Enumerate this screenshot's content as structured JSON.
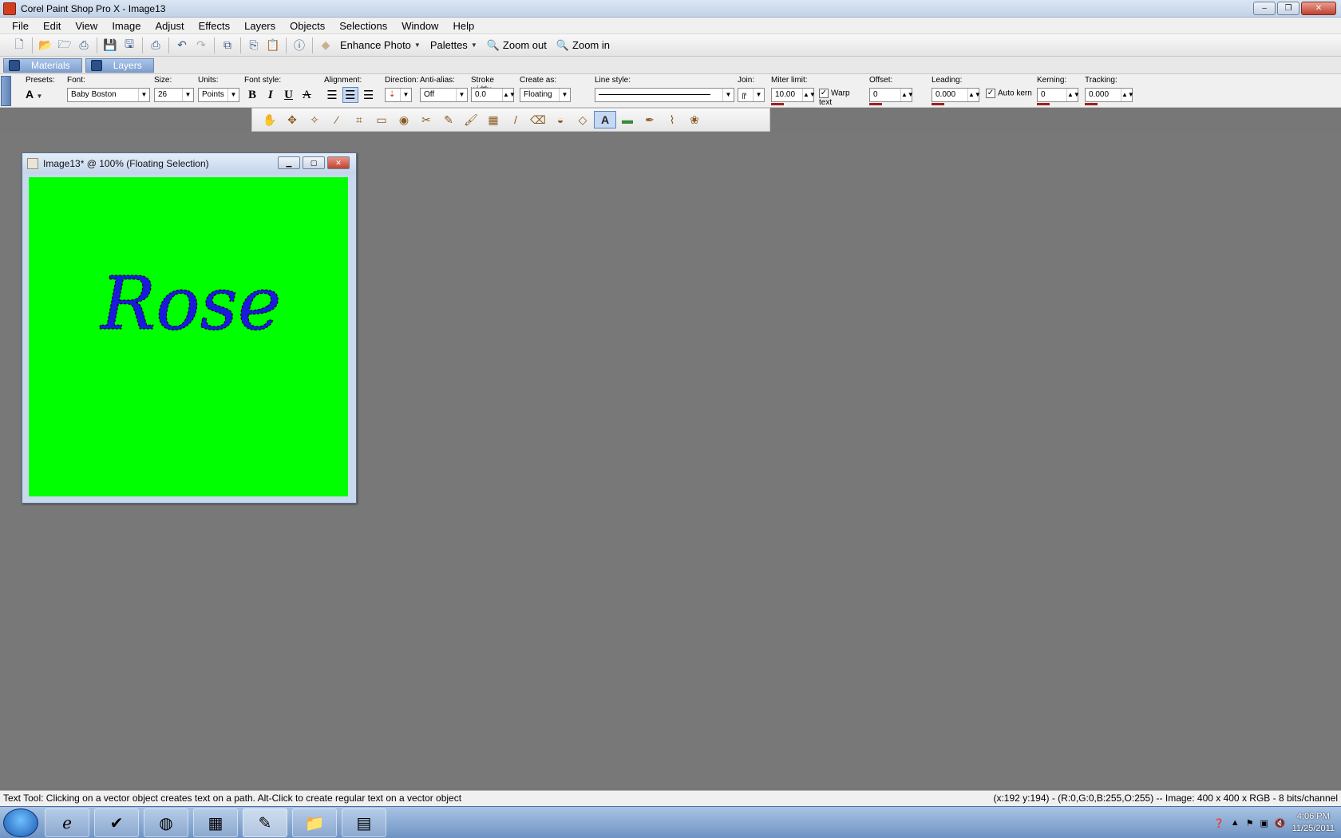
{
  "window": {
    "title": "Corel Paint Shop Pro X - Image13",
    "min": "–",
    "max": "❐",
    "close": "✕"
  },
  "menu": [
    "File",
    "Edit",
    "View",
    "Image",
    "Adjust",
    "Effects",
    "Layers",
    "Objects",
    "Selections",
    "Window",
    "Help"
  ],
  "toolbar": {
    "enhance_photo": "Enhance Photo",
    "palettes": "Palettes",
    "zoom_out": "Zoom out",
    "zoom_in": "Zoom in"
  },
  "palette_tabs": {
    "materials": "Materials",
    "layers": "Layers"
  },
  "options": {
    "presets_label": "Presets:",
    "presets_value": "A",
    "font_label": "Font:",
    "font_value": "Baby Boston",
    "size_label": "Size:",
    "size_value": "26",
    "units_label": "Units:",
    "units_value": "Points",
    "fontstyle_label": "Font style:",
    "bold": "B",
    "italic": "I",
    "underline": "U",
    "strike": "A",
    "alignment_label": "Alignment:",
    "direction_label": "Direction:",
    "antialias_label": "Anti-alias:",
    "antialias_value": "Off",
    "stroke_label": "Stroke width:",
    "stroke_value": "0.0",
    "createas_label": "Create as:",
    "createas_value": "Floating",
    "linestyle_label": "Line style:",
    "join_label": "Join:",
    "miter_label": "Miter limit:",
    "miter_value": "10.00",
    "warp_label": "Warp text",
    "warp_checked": true,
    "offset_label": "Offset:",
    "offset_value": "0",
    "leading_label": "Leading:",
    "leading_value": "0.000",
    "autokern_label": "Auto kern",
    "autokern_checked": true,
    "kerning_label": "Kerning:",
    "kerning_value": "0",
    "tracking_label": "Tracking:",
    "tracking_value": "0.000"
  },
  "image_window": {
    "title": "Image13* @ 100% (Floating Selection)",
    "canvas_color": "#00ff00",
    "text": "Rose",
    "text_color": "#1a1adc"
  },
  "status": {
    "left": "Text Tool: Clicking on a vector object creates text on a path. Alt-Click to create regular text on a vector object",
    "right": "(x:192 y:194) - (R:0,G:0,B:255,O:255) -- Image:  400 x 400 x RGB - 8 bits/channel"
  },
  "taskbar": {
    "time": "4:06 PM",
    "date": "11/25/2011"
  },
  "icons": {
    "new": "new-file-icon",
    "open": "open-icon",
    "save": "save-icon",
    "undo": "undo-icon",
    "redo": "redo-icon",
    "info": "info-icon",
    "zoom": "magnifier-icon"
  }
}
